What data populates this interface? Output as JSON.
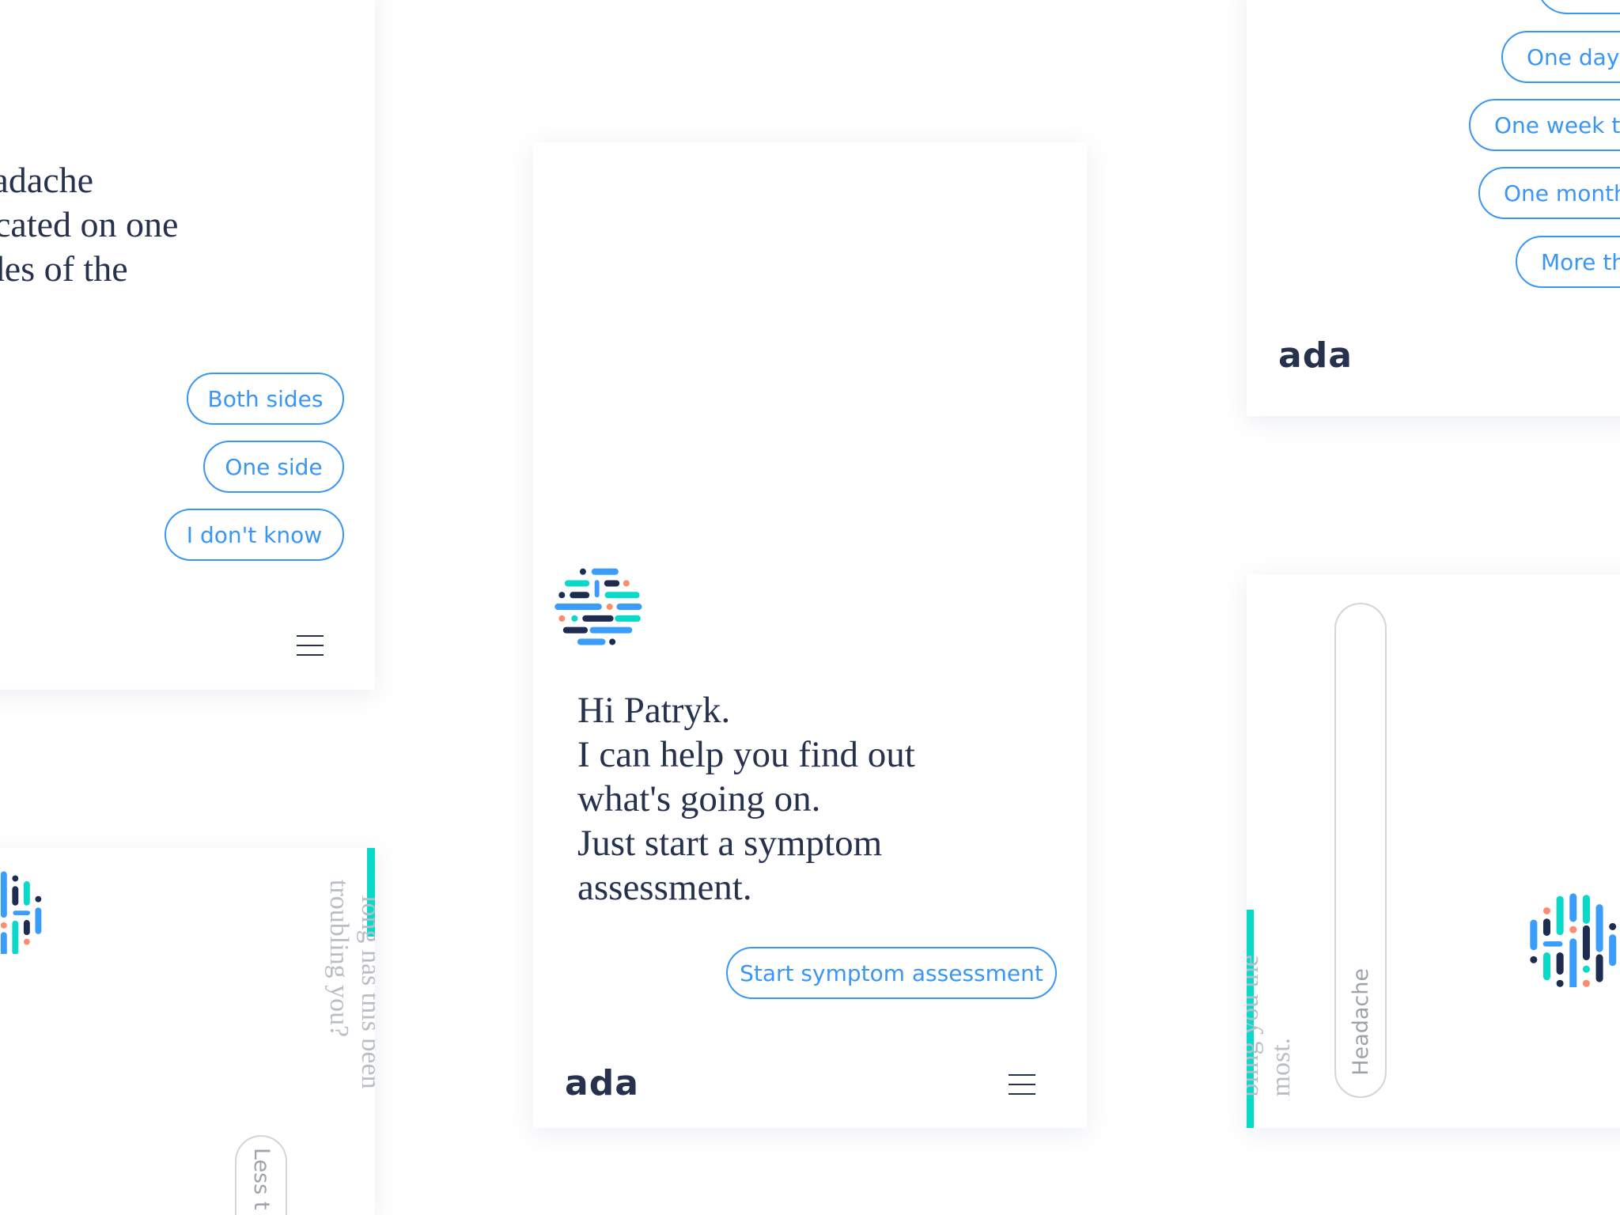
{
  "colors": {
    "accent_blue": "#3a96f5",
    "navy": "#1d2c4f",
    "teal": "#08d9c8",
    "orange": "#fb8c6e",
    "muted_text": "#b9bdc6"
  },
  "top_left_card": {
    "question_lines": [
      "eadache",
      "ocated on one",
      "ides of the"
    ],
    "options": [
      "Both sides",
      "One side",
      "I don't know"
    ],
    "menu_icon": "hamburger-icon"
  },
  "top_right_card": {
    "options": [
      "One day t",
      "One week to",
      "One month",
      "More th"
    ],
    "logo_text": "ada"
  },
  "main_card": {
    "greeting_lines": [
      "Hi Patryk.",
      "I can help you find out",
      "what's going on.",
      "Just start a symptom",
      "assessment."
    ],
    "start_button": "Start symptom assessment",
    "logo_text": "ada",
    "menu_icon": "hamburger-icon"
  },
  "bottom_left_card": {
    "question_lines": [
      "long has this been",
      "troubling you?"
    ],
    "option": "Less t"
  },
  "bottom_right_card": {
    "question_lines": [
      "bling you the",
      "most."
    ],
    "option": "Headache"
  }
}
